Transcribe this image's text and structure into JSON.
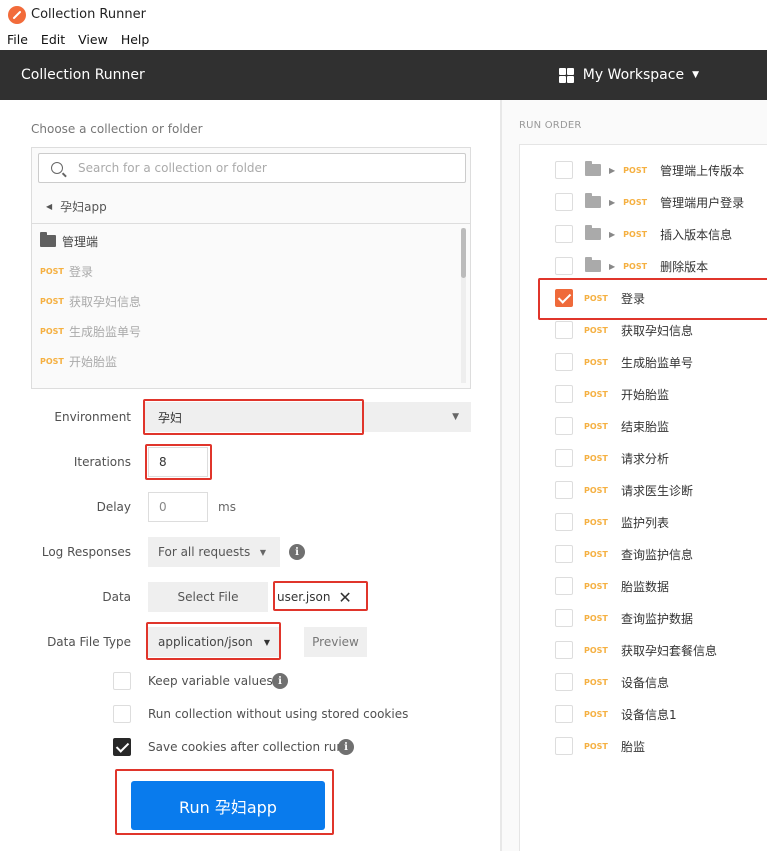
{
  "window": {
    "title": "Collection Runner"
  },
  "menu": [
    "File",
    "Edit",
    "View",
    "Help"
  ],
  "header": {
    "title": "Collection Runner",
    "workspace": "My Workspace"
  },
  "chooser": {
    "label": "Choose a collection or folder",
    "search_placeholder": "Search for a collection or folder",
    "breadcrumb": "孕妇app",
    "folder": "管理端",
    "requests": [
      {
        "method": "POST",
        "name": "登录"
      },
      {
        "method": "POST",
        "name": "获取孕妇信息"
      },
      {
        "method": "POST",
        "name": "生成胎监单号"
      },
      {
        "method": "POST",
        "name": "开始胎监"
      }
    ]
  },
  "form": {
    "environment_label": "Environment",
    "environment_value": "孕妇",
    "iterations_label": "Iterations",
    "iterations_value": "8",
    "delay_label": "Delay",
    "delay_value": "0",
    "delay_unit": "ms",
    "log_label": "Log Responses",
    "log_value": "For all requests",
    "data_label": "Data",
    "select_file": "Select File",
    "file_name": "user.json",
    "data_file_type_label": "Data File Type",
    "data_file_type_value": "application/json",
    "preview": "Preview",
    "keep_variable": "Keep variable values",
    "no_cookies": "Run collection without using stored cookies",
    "save_cookies": "Save cookies after collection run",
    "keep_variable_checked": false,
    "no_cookies_checked": false,
    "save_cookies_checked": true,
    "run_button": "Run 孕妇app"
  },
  "run_order": {
    "label": "RUN ORDER",
    "items": [
      {
        "folder": true,
        "method": "POST",
        "name": "管理端上传版本",
        "checked": false
      },
      {
        "folder": true,
        "method": "POST",
        "name": "管理端用户登录",
        "checked": false
      },
      {
        "folder": true,
        "method": "POST",
        "name": "插入版本信息",
        "checked": false
      },
      {
        "folder": true,
        "method": "POST",
        "name": "删除版本",
        "checked": false
      },
      {
        "folder": false,
        "method": "POST",
        "name": "登录",
        "checked": true
      },
      {
        "folder": false,
        "method": "POST",
        "name": "获取孕妇信息",
        "checked": false
      },
      {
        "folder": false,
        "method": "POST",
        "name": "生成胎监单号",
        "checked": false
      },
      {
        "folder": false,
        "method": "POST",
        "name": "开始胎监",
        "checked": false
      },
      {
        "folder": false,
        "method": "POST",
        "name": "结束胎监",
        "checked": false
      },
      {
        "folder": false,
        "method": "POST",
        "name": "请求分析",
        "checked": false
      },
      {
        "folder": false,
        "method": "POST",
        "name": "请求医生诊断",
        "checked": false
      },
      {
        "folder": false,
        "method": "POST",
        "name": "监护列表",
        "checked": false
      },
      {
        "folder": false,
        "method": "POST",
        "name": "查询监护信息",
        "checked": false
      },
      {
        "folder": false,
        "method": "POST",
        "name": "胎监数据",
        "checked": false
      },
      {
        "folder": false,
        "method": "POST",
        "name": "查询监护数据",
        "checked": false
      },
      {
        "folder": false,
        "method": "POST",
        "name": "获取孕妇套餐信息",
        "checked": false
      },
      {
        "folder": false,
        "method": "POST",
        "name": "设备信息",
        "checked": false
      },
      {
        "folder": false,
        "method": "POST",
        "name": "设备信息1",
        "checked": false
      },
      {
        "folder": false,
        "method": "POST",
        "name": "胎监",
        "checked": false
      }
    ]
  },
  "colors": {
    "accent_run": "#097bed",
    "highlight_box": "#e0352b",
    "post": "#f5b041",
    "checked": "#ef6a3a"
  }
}
